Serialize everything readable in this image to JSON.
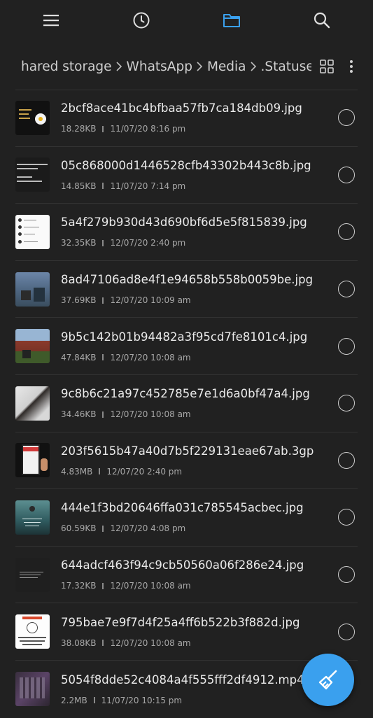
{
  "toolbar": {
    "menu_icon": "hamburger-menu-icon",
    "recent_icon": "clock-icon",
    "folder_icon": "folder-icon",
    "search_icon": "search-icon",
    "active_color": "#3aa0ee"
  },
  "breadcrumb": {
    "items": [
      "hared storage",
      "WhatsApp",
      "Media",
      ".Statuses"
    ]
  },
  "files": [
    {
      "name": "2bcf8ace41bc4bfbaa57fb7ca184db09.jpg",
      "size": "18.28KB",
      "date": "11/07/20 8:16 pm"
    },
    {
      "name": "05c868000d1446528cfb43302b443c8b.jpg",
      "size": "14.85KB",
      "date": "11/07/20 7:14 pm"
    },
    {
      "name": "5a4f279b930d43d690bf6d5e5f815839.jpg",
      "size": "32.35KB",
      "date": "12/07/20 2:40 pm"
    },
    {
      "name": "8ad47106ad8e4f1e94658b558b0059be.jpg",
      "size": "37.69KB",
      "date": "12/07/20 10:09 am"
    },
    {
      "name": "9b5c142b01b94482a3f95cd7fe8101c4.jpg",
      "size": "47.84KB",
      "date": "12/07/20 10:08 am"
    },
    {
      "name": "9c8b6c21a97c452785e7e1d6a0bf47a4.jpg",
      "size": "34.46KB",
      "date": "12/07/20 10:08 am"
    },
    {
      "name": "203f5615b47a40d7b5f229131eae67ab.3gp",
      "size": "4.83MB",
      "date": "12/07/20 2:40 pm"
    },
    {
      "name": "444e1f3bd20646ffa031c785545acbec.jpg",
      "size": "60.59KB",
      "date": "12/07/20 4:08 pm"
    },
    {
      "name": "644adcf463f94c9cb50560a06f286e24.jpg",
      "size": "17.32KB",
      "date": "12/07/20 10:08 am"
    },
    {
      "name": "795bae7e9f7d4f25a4ff6b522b3f882d.jpg",
      "size": "38.08KB",
      "date": "12/07/20 10:08 am"
    },
    {
      "name": "5054f8dde52c4084a4f555fff2df4912.mp4",
      "size": "2.2MB",
      "date": "11/07/20 10:15 pm"
    }
  ],
  "fab": {
    "icon": "broom-clean-icon",
    "color": "#3aa0ee"
  }
}
